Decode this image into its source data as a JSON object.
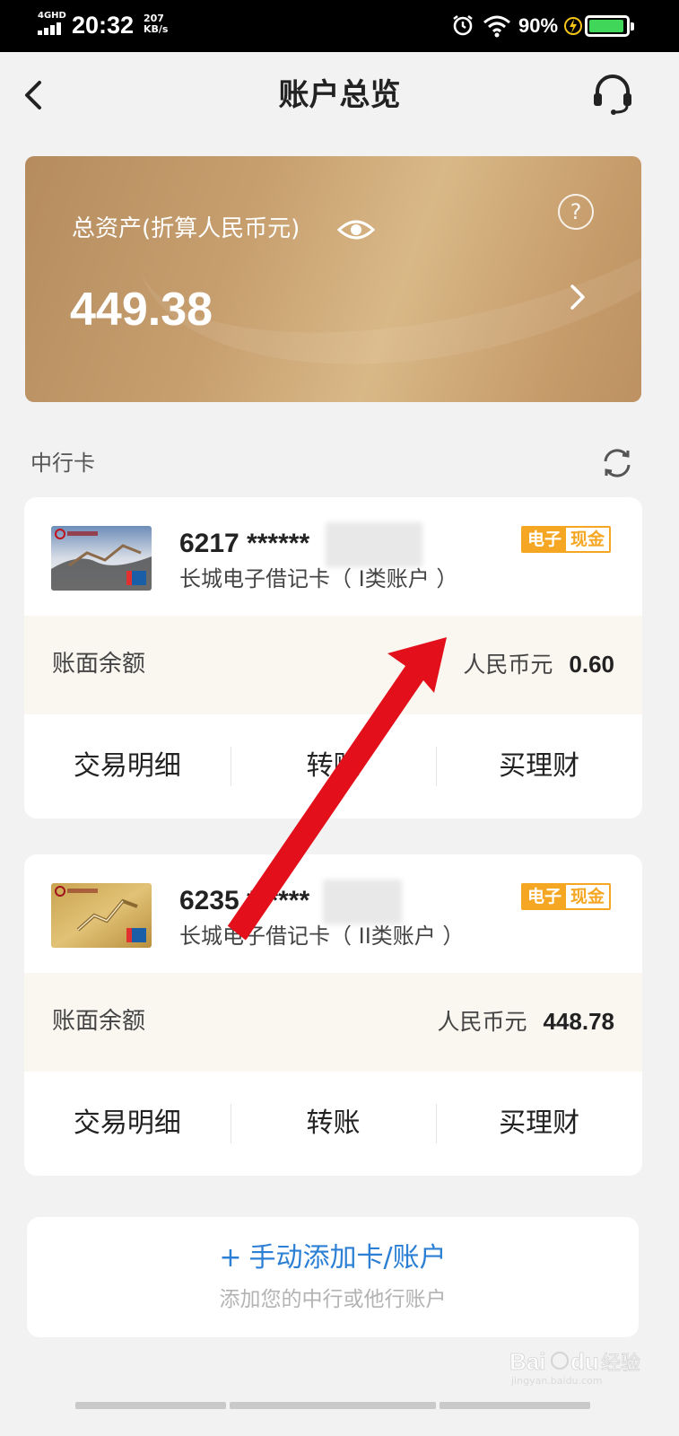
{
  "status_bar": {
    "network": "4GHD",
    "time": "20:32",
    "speed_value": "207",
    "speed_unit": "KB/s",
    "battery_percent": "90%",
    "battery_level": 0.9,
    "battery_color": "#3fd65a"
  },
  "nav": {
    "title": "账户总览",
    "back_icon": "chevron-left-icon",
    "service_icon": "headset-icon"
  },
  "assets": {
    "label": "总资产(折算人民币元)",
    "amount": "449.38",
    "help_symbol": "?"
  },
  "section": {
    "title": "中行卡"
  },
  "accounts": [
    {
      "number": "6217 ******",
      "type": "长城电子借记卡（ I类账户 ）",
      "tag_left": "电子",
      "tag_right": "现金",
      "balance_label": "账面余额",
      "currency": "人民币元",
      "balance": "0.60",
      "actions": [
        "交易明细",
        "转账",
        "买理财"
      ]
    },
    {
      "number": "6235 ******",
      "type": "长城电子借记卡（ II类账户 ）",
      "tag_left": "电子",
      "tag_right": "现金",
      "balance_label": "账面余额",
      "currency": "人民币元",
      "balance": "448.78",
      "actions": [
        "交易明细",
        "转账",
        "买理财"
      ]
    }
  ],
  "add_account": {
    "plus": "+",
    "title": "手动添加卡/账户",
    "subtitle": "添加您的中行或他行账户"
  },
  "watermark": {
    "brand": "Baidu经验",
    "url": "jingyan.baidu.com"
  },
  "colors": {
    "accent_blue": "#2b7fd4",
    "tag_orange": "#f5a623",
    "annotation_red": "#e3101b"
  }
}
